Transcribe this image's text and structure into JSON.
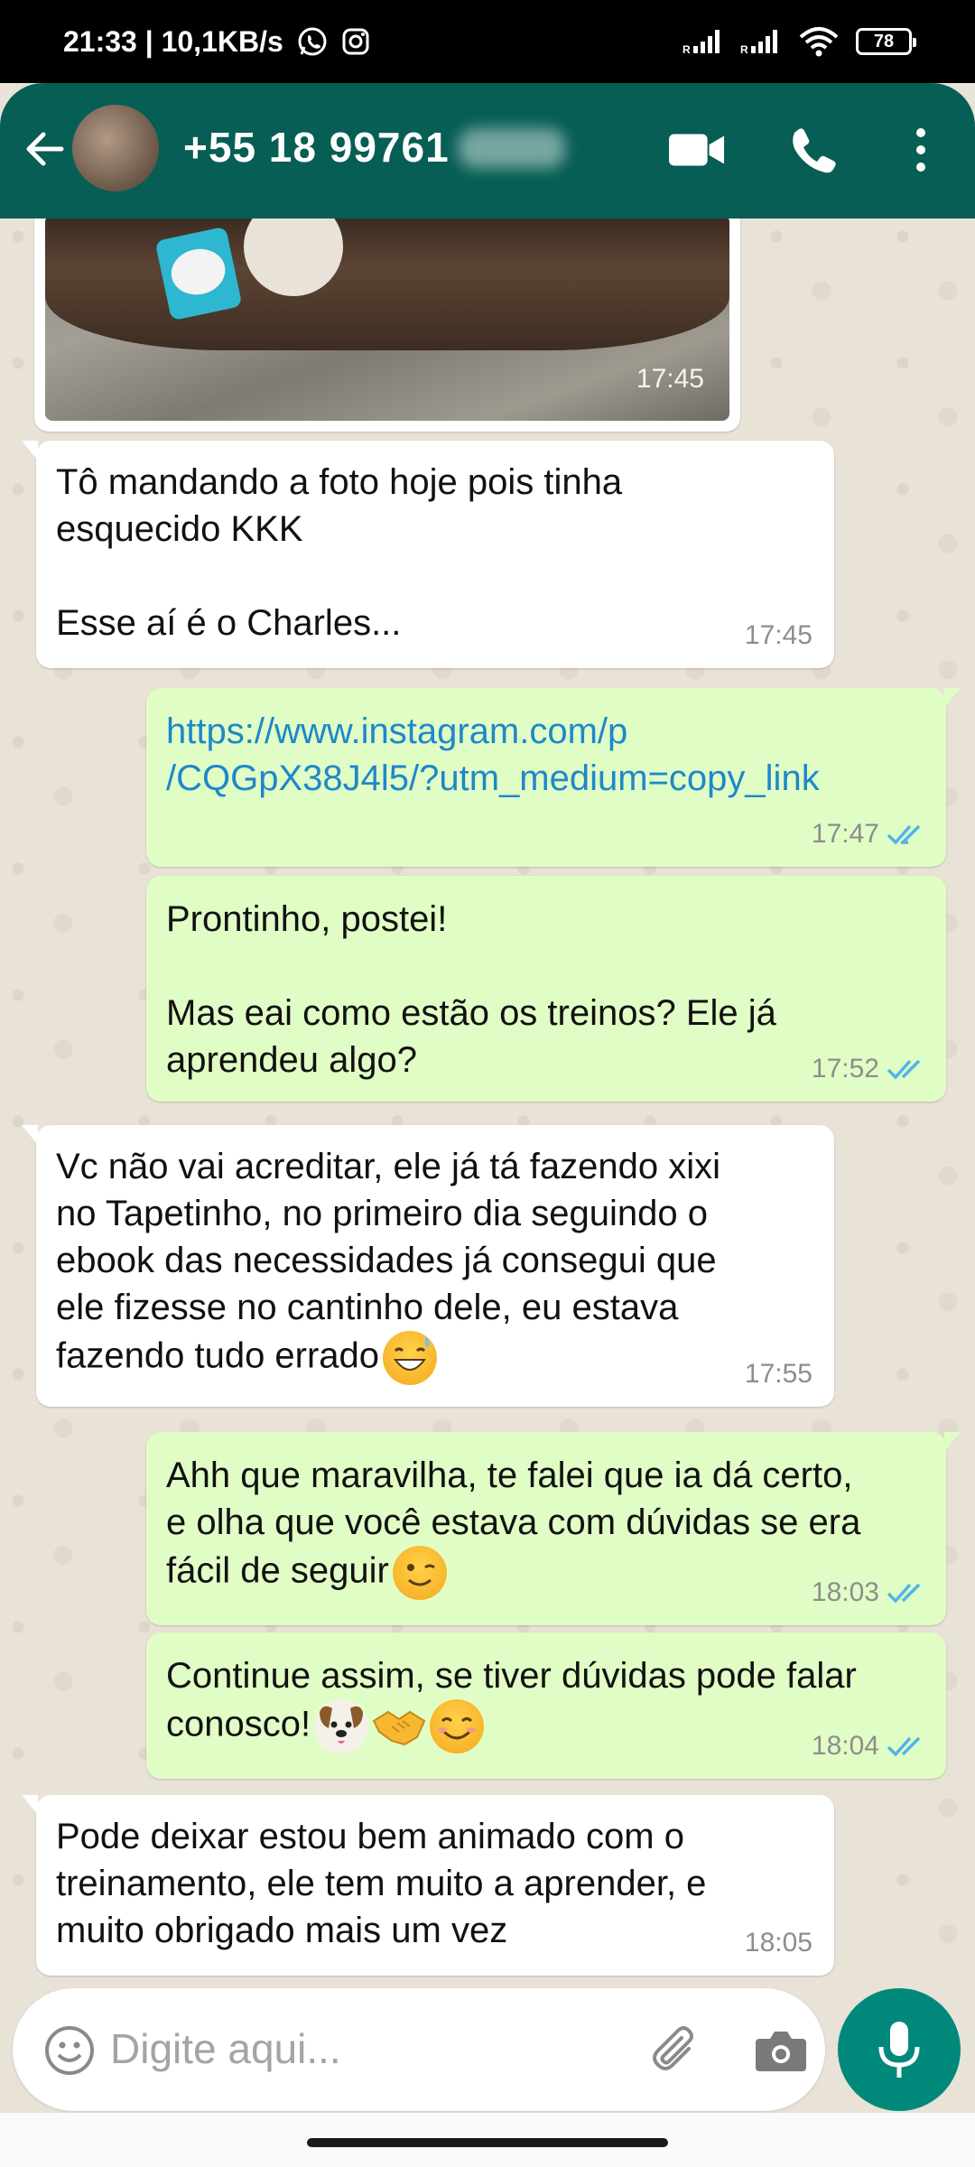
{
  "status_bar": {
    "time_speed": "21:33 | 10,1KB/s",
    "battery": "78",
    "icons": [
      "whatsapp-icon",
      "instagram-icon",
      "signal-icon",
      "signal-icon",
      "wifi-icon",
      "battery-icon"
    ]
  },
  "header": {
    "contact_name": "+55 18 99761",
    "icons": [
      "back-arrow-icon",
      "video-call-icon",
      "phone-icon",
      "more-vertical-icon"
    ],
    "color": "#075e54"
  },
  "messages": [
    {
      "type": "image",
      "direction": "in",
      "time": "17:45"
    },
    {
      "direction": "in",
      "text": "Tô mandando a foto hoje pois tinha\nesquecido KKK\n\nEsse aí é o Charles...",
      "time": "17:45"
    },
    {
      "direction": "out",
      "text": "https://www.instagram.com/p\n/CQGpX38J4l5/?utm_medium=copy_link",
      "time": "17:47",
      "read": true
    },
    {
      "direction": "out",
      "text": "Prontinho, postei!\n\nMas eai como estão os treinos? Ele já\naprendeu algo?",
      "time": "17:52",
      "read": true
    },
    {
      "direction": "in",
      "text": "Vc não vai acreditar, ele já tá fazendo xixi\nno Tapetinho, no primeiro dia seguindo o\nebook das necessidades já consegui que\nele fizesse no cantinho dele, eu estava\nfazendo tudo errado",
      "emoji": [
        "grinning-sweat-emoji"
      ],
      "time": "17:55"
    },
    {
      "direction": "out",
      "text": "Ahh que maravilha, te falei que ia dá certo,\ne olha que você estava com dúvidas se era\nfácil de seguir",
      "emoji": [
        "winking-face-emoji"
      ],
      "time": "18:03",
      "read": true
    },
    {
      "direction": "out",
      "text": "Continue assim, se tiver dúvidas pode falar\nconosco!",
      "emoji": [
        "dog-face-emoji",
        "handshake-emoji",
        "smiling-face-emoji"
      ],
      "time": "18:04",
      "read": true
    },
    {
      "direction": "in",
      "text": "Pode deixar estou bem animado com o\ntreinamento, ele tem muito a aprender, e\nmuito obrigado mais um vez",
      "time": "18:05"
    }
  ],
  "input": {
    "placeholder": "Digite aqui...",
    "icons": [
      "emoji-icon",
      "attach-icon",
      "camera-icon",
      "mic-icon"
    ]
  },
  "colors": {
    "incoming_bubble": "#ffffff",
    "outgoing_bubble": "#e1fdc6",
    "chat_background": "#e9e2d7",
    "read_ticks": "#4fb5e8",
    "link": "#1e88c9",
    "mic_button": "#00897b"
  }
}
